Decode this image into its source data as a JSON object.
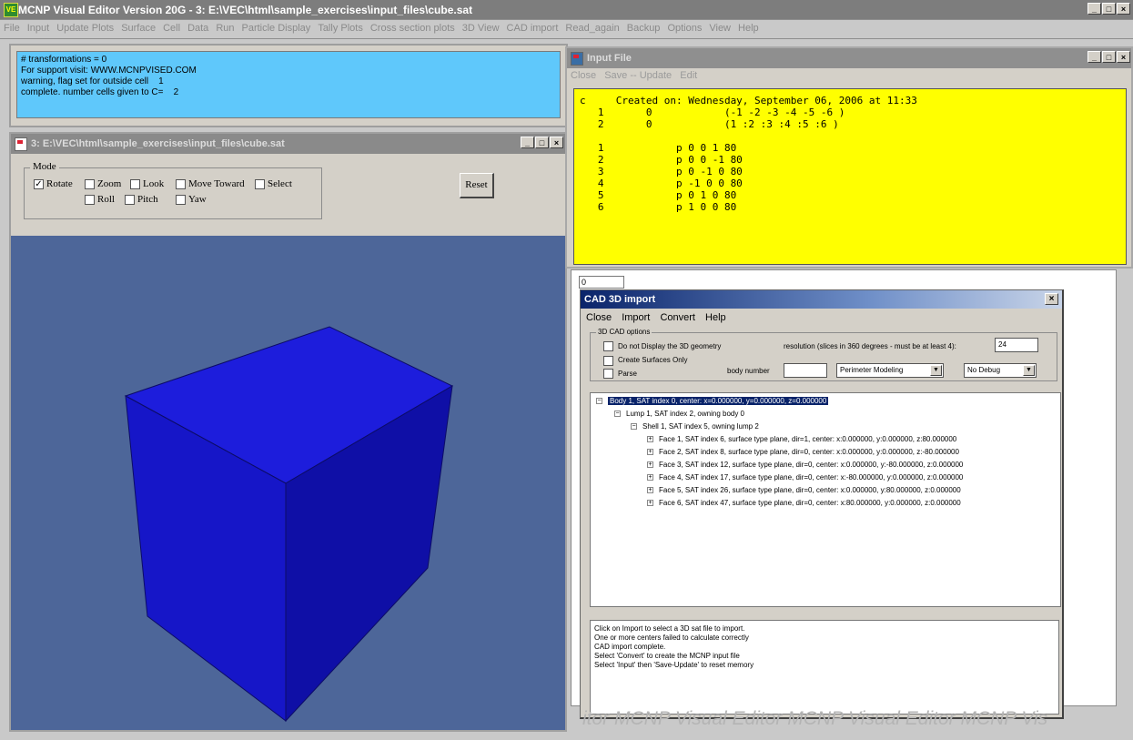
{
  "app": {
    "title": "MCNP Visual Editor Version 20G - 3: E:\\VEC\\html\\sample_exercises\\input_files\\cube.sat",
    "icon_label": "VE"
  },
  "menu": [
    "File",
    "Input",
    "Update Plots",
    "Surface",
    "Cell",
    "Data",
    "Run",
    "Particle Display",
    "Tally Plots",
    "Cross section plots",
    "3D View",
    "CAD import",
    "Read_again",
    "Backup",
    "Options",
    "View",
    "Help"
  ],
  "window_controls": {
    "minimize": "_",
    "maximize": "□",
    "close": "×"
  },
  "messages": [
    "# transformations = 0",
    "For support visit: WWW.MCNPVISED.COM",
    "warning, flag set for outside cell    1",
    "complete. number cells given to C=    2"
  ],
  "cube_window": {
    "title": "3: E:\\VEC\\html\\sample_exercises\\input_files\\cube.sat",
    "mode_label": "Mode",
    "options": {
      "rotate": {
        "label": "Rotate",
        "checked": true
      },
      "zoom": {
        "label": "Zoom",
        "checked": false
      },
      "look": {
        "label": "Look",
        "checked": false
      },
      "move_toward": {
        "label": "Move Toward",
        "checked": false
      },
      "select": {
        "label": "Select",
        "checked": false
      },
      "roll": {
        "label": "Roll",
        "checked": false
      },
      "pitch": {
        "label": "Pitch",
        "checked": false
      },
      "yaw": {
        "label": "Yaw",
        "checked": false
      }
    },
    "reset_label": "Reset",
    "colors": {
      "background": "#4d6699",
      "cube_front": "#1616c8",
      "cube_top": "#1d1ddc",
      "cube_right": "#0f0fa6"
    }
  },
  "input_window": {
    "title": "Input File",
    "menu": [
      "Close",
      "Save -- Update",
      "Edit"
    ],
    "lines": [
      "c     Created on: Wednesday, September 06, 2006 at 11:33",
      "   1       0            (-1 -2 -3 -4 -5 -6 )",
      "   2       0            (1 :2 :3 :4 :5 :6 )",
      "",
      "   1            p 0 0 1 80",
      "   2            p 0 0 -1 80",
      "   3            p 0 -1 0 80",
      "   4            p -1 0 0 80",
      "   5            p 0 1 0 80",
      "   6            p 1 0 0 80"
    ],
    "background": "#ffff00"
  },
  "bg_field_value": "0",
  "cad_window": {
    "title": "CAD 3D import",
    "menu": [
      "Close",
      "Import",
      "Convert",
      "Help"
    ],
    "group_label": "3D CAD options",
    "do_not_display": "Do not Display the 3D geometry",
    "create_surfaces": "Create Surfaces Only",
    "parse": "Parse",
    "resolution_label": "resolution (slices in 360 degrees - must be at least 4):",
    "resolution_value": "24",
    "body_number_label": "body number",
    "body_number_value": "",
    "modeling_select": "Perimeter Modeling",
    "debug_select": "No Debug",
    "tree": {
      "body": "Body 1, SAT index 0, center: x=0.000000, y=0.000000, z=0.000000",
      "lump": "Lump 1, SAT index 2, owning body 0",
      "shell": "Shell 1, SAT index 5, owning lump 2",
      "faces": [
        "Face 1, SAT index 6, surface type plane, dir=1, center: x:0.000000, y:0.000000, z:80.000000",
        "Face 2, SAT index 8, surface type plane, dir=0, center: x:0.000000, y:0.000000, z:-80.000000",
        "Face 3, SAT index 12, surface type plane, dir=0, center: x:0.000000, y:-80.000000, z:0.000000",
        "Face 4, SAT index 17, surface type plane, dir=0, center: x:-80.000000, y:0.000000, z:0.000000",
        "Face 5, SAT index 26, surface type plane, dir=0, center: x:0.000000, y:80.000000, z:0.000000",
        "Face 6, SAT index 47, surface type plane, dir=0, center: x:80.000000, y:0.000000, z:0.000000"
      ]
    },
    "status": [
      "Click on Import to select a 3D sat file to import.",
      "One or more centers failed to calculate correctly",
      "CAD import complete.",
      "Select 'Convert' to create the MCNP input file",
      "Select 'Input' then 'Save-Update' to reset memory"
    ]
  },
  "watermark": "itor   MCNP Visual Editor   MCNP Visual Editor   MCNP Vis"
}
